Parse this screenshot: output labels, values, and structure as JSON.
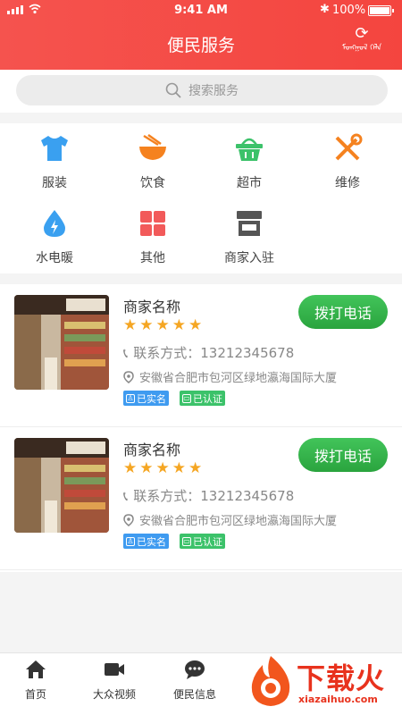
{
  "status_bar": {
    "time": "9:41 AM",
    "battery": "100%",
    "battery_level": 1.0
  },
  "header": {
    "title": "便民服务",
    "refresh_label": "ᠮᠣᠩᠭᠣᠯ ᠬᠡᠯᠡ"
  },
  "search": {
    "placeholder": "搜索服务",
    "icon": "search-icon"
  },
  "categories": [
    {
      "label": "服装",
      "icon": "shirt-icon",
      "color": "#3aa0f0"
    },
    {
      "label": "饮食",
      "icon": "bowl-icon",
      "color": "#f5821f"
    },
    {
      "label": "超市",
      "icon": "basket-icon",
      "color": "#3cc26a"
    },
    {
      "label": "维修",
      "icon": "tools-icon",
      "color": "#f5821f"
    },
    {
      "label": "水电暖",
      "icon": "water-drop-icon",
      "color": "#3aa0f0"
    },
    {
      "label": "其他",
      "icon": "grid-icon",
      "color": "#f25a5a"
    },
    {
      "label": "商家入驻",
      "icon": "shop-icon",
      "color": "#555555"
    }
  ],
  "merchants": [
    {
      "name": "商家名称",
      "rating": 5,
      "contact": "联系方式：13212345678",
      "address": "安徽省合肥市包河区绿地瀛海国际大厦",
      "badge_realname": "已实名",
      "badge_verified": "已认证",
      "call_label": "拨打电话"
    },
    {
      "name": "商家名称",
      "rating": 5,
      "contact": "联系方式：13212345678",
      "address": "安徽省合肥市包河区绿地瀛海国际大厦",
      "badge_realname": "已实名",
      "badge_verified": "已认证",
      "call_label": "拨打电话"
    }
  ],
  "tabbar": [
    {
      "label": "首页",
      "icon": "home-icon"
    },
    {
      "label": "大众视频",
      "icon": "video-icon"
    },
    {
      "label": "便民信息",
      "icon": "chat-icon"
    }
  ],
  "watermark": {
    "text": "下载火",
    "url": "xiazaihuo.com"
  },
  "colors": {
    "header": "#f4453f",
    "call_button": "#2aa43e",
    "star": "#f5a623",
    "badge_blue": "#3f9bf0",
    "badge_green": "#3cc26a"
  }
}
